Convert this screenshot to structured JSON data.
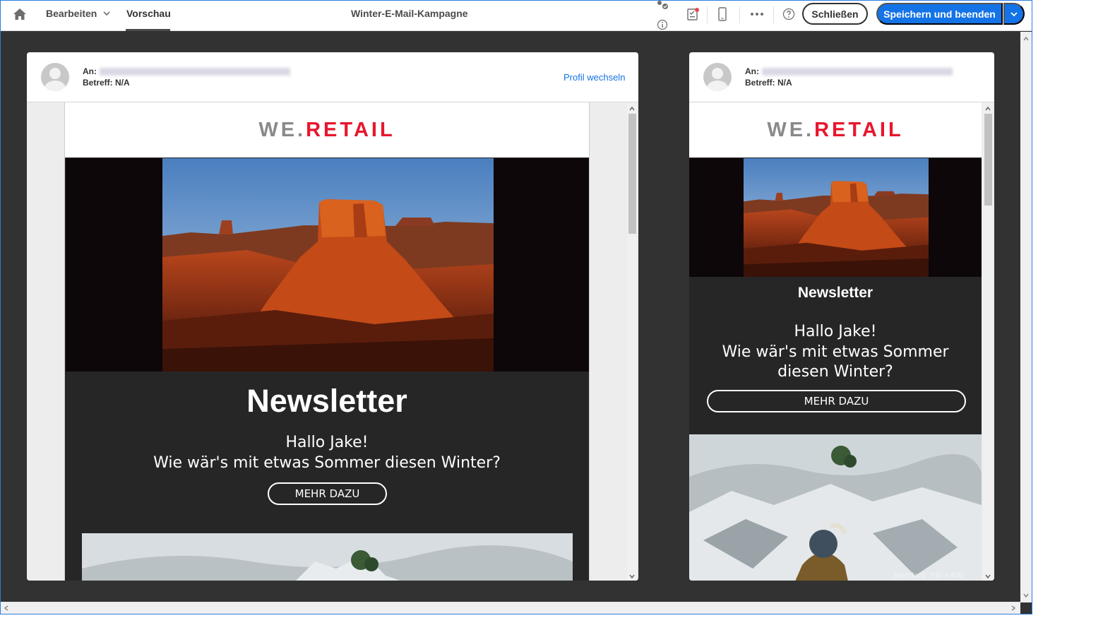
{
  "topbar": {
    "tab_edit": "Bearbeiten",
    "tab_preview": "Vorschau",
    "title": "Winter-E-Mail-Kampagne",
    "close_label": "Schließen",
    "save_label": "Speichern und beenden",
    "icons": [
      "home-icon",
      "chevron-down-icon",
      "user-check-icon",
      "info-icon",
      "proof-checklist-icon",
      "mobile-device-icon",
      "more-icon",
      "help-icon"
    ]
  },
  "preview_header": {
    "to_label": "An:",
    "subject": "Betreff: N/A",
    "profile_link": "Profil wechseln"
  },
  "email": {
    "logo_we": "WE.",
    "logo_retail": "RETAIL",
    "newsletter_title": "Newsletter",
    "greeting_line1": "Hallo Jake!",
    "greeting_line2": "Wie wär's mit etwas Sommer diesen Winter?",
    "mobile_line2": "Wie wär's mit etwas Sommer",
    "mobile_line3": "diesen Winter?",
    "cta": "MEHR DAZU",
    "image_label": "Standard: 700 x 400"
  },
  "colors": {
    "accent": "#1473e6",
    "brand_red": "#e8162d",
    "email_bg": "#262626",
    "canvas_bg": "#323232"
  }
}
